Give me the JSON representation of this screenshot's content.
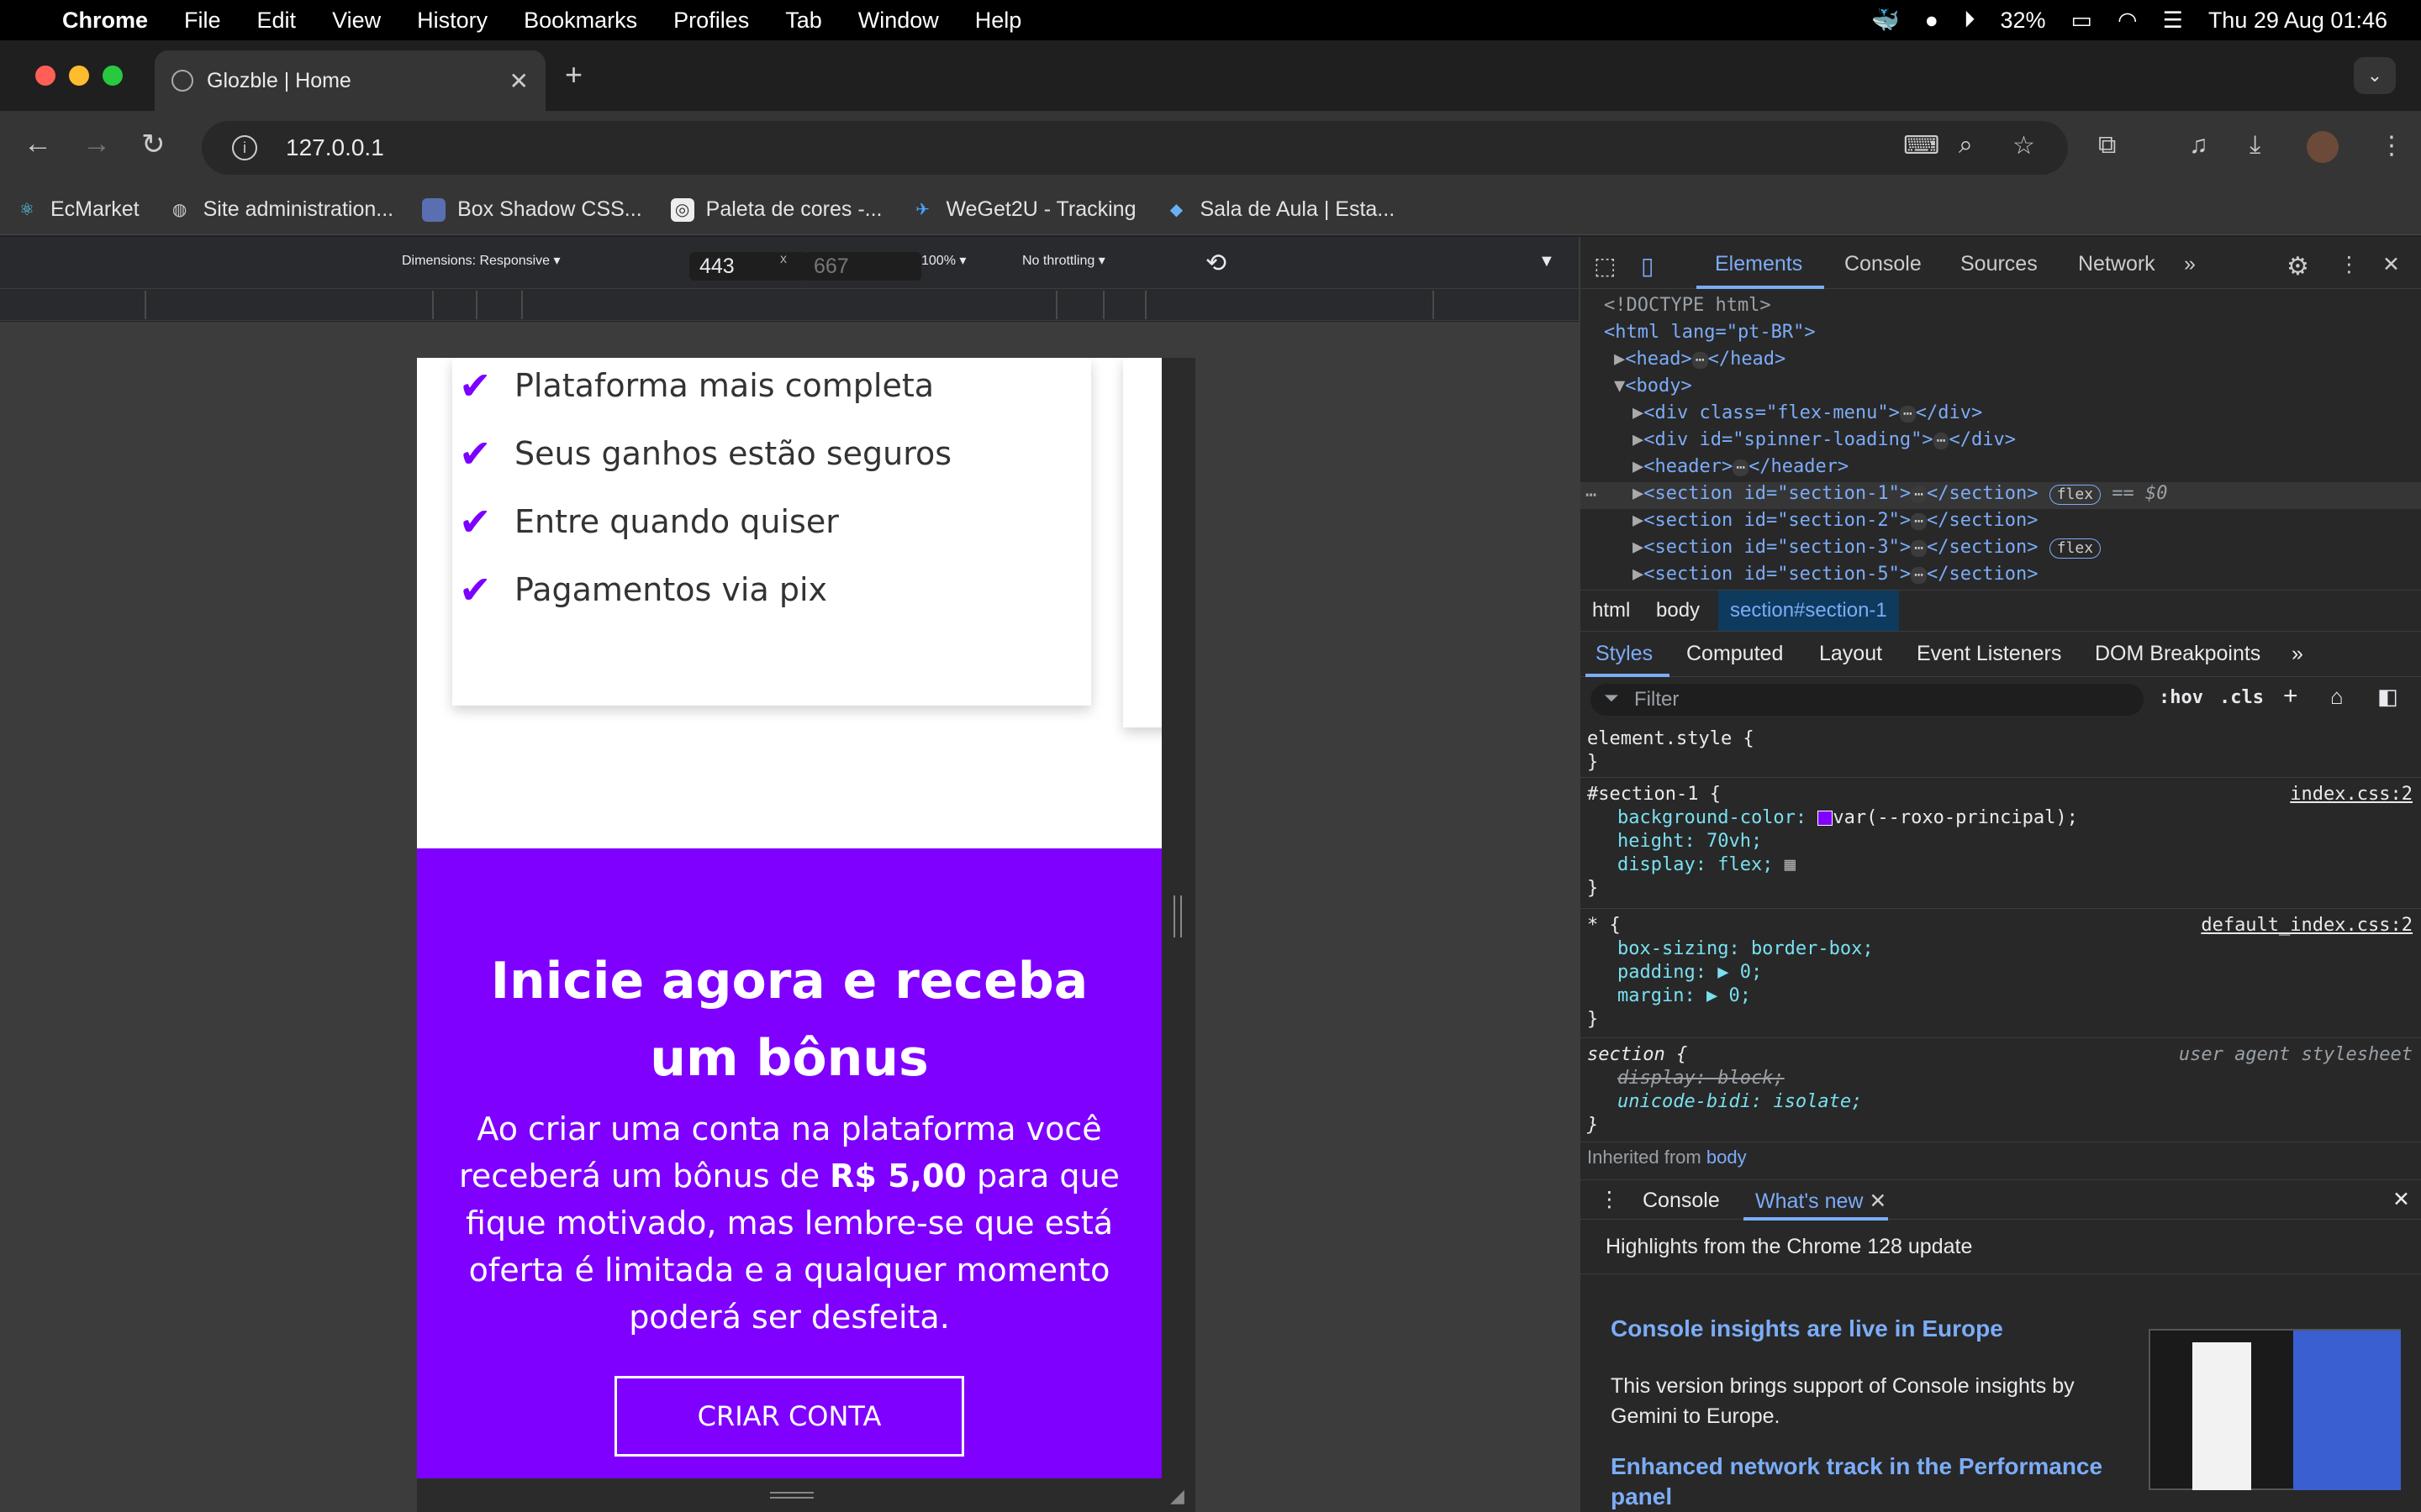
{
  "menubar": {
    "app": "Chrome",
    "items": [
      "File",
      "Edit",
      "View",
      "History",
      "Bookmarks",
      "Profiles",
      "Tab",
      "Window",
      "Help"
    ],
    "battery": "32%",
    "datetime": "Thu 29 Aug  01:46"
  },
  "tab": {
    "title": "Glozble | Home"
  },
  "omnibox": {
    "url": "127.0.0.1"
  },
  "bookmarks": [
    {
      "label": "EcMarket",
      "icon": "react-icon"
    },
    {
      "label": "Site administration...",
      "icon": "globe-icon"
    },
    {
      "label": "Box Shadow CSS...",
      "icon": "box-icon"
    },
    {
      "label": "Paleta de cores -...",
      "icon": "palette-icon"
    },
    {
      "label": "WeGet2U - Tracking",
      "icon": "tracking-icon"
    },
    {
      "label": "Sala de Aula | Esta...",
      "icon": "diamond-icon"
    }
  ],
  "device_toolbar": {
    "dimensions": "Dimensions: Responsive",
    "width": "443",
    "height": "667",
    "zoom": "100%",
    "throttling": "No throttling",
    "times": "x"
  },
  "page": {
    "features": [
      "Plataforma mais completa",
      "Seus ganhos estão seguros",
      "Entre quando quiser",
      "Pagamentos via pix"
    ],
    "cta_title": "Inicie agora e receba um bônus",
    "cta_text_before": "Ao criar uma conta na plataforma você receberá um bônus de",
    "cta_bonus": "R$ 5,00",
    "cta_text_after": "para que fique motivado, mas lembre-se que está oferta é limitada e a qualquer momento poderá ser desfeita.",
    "cta_button": "CRIAR CONTA"
  },
  "devtools": {
    "tabs": [
      "Elements",
      "Console",
      "Sources",
      "Network"
    ],
    "dom": {
      "doctype": "<!DOCTYPE html>",
      "html_open": "<html lang=\"pt-BR\">",
      "head": "<head>",
      "head_close": "</head>",
      "body": "<body>",
      "div_flex": "<div class=\"flex-menu\">",
      "div_close": "</div>",
      "div_spinner": "<div id=\"spinner-loading\">",
      "header": "<header>",
      "header_close": "</header>",
      "section1": "<section id=\"section-1\">",
      "section2": "<section id=\"section-2\">",
      "section3": "<section id=\"section-3\">",
      "section5": "<section id=\"section-5\">",
      "section_close": "</section>",
      "flex_badge": "flex",
      "eq": "== $0"
    },
    "breadcrumbs": [
      "html",
      "body",
      "section#section-1"
    ],
    "style_tabs": [
      "Styles",
      "Computed",
      "Layout",
      "Event Listeners",
      "DOM Breakpoints"
    ],
    "filter_placeholder": "Filter",
    "hov": ":hov",
    "cls": ".cls",
    "rules": {
      "element_style": "element.style {",
      "close": "}",
      "s1_selector": "#section-1 {",
      "s1_source": "index.css:2",
      "s1_bg": "background-color: ",
      "s1_bg_val": "var(--roxo-principal);",
      "s1_height": "height: 70vh;",
      "s1_display": "display: flex;",
      "star_selector": "* {",
      "star_source": "default_index.css:2",
      "star_box": "box-sizing: border-box;",
      "star_padding": "padding: ▶ 0;",
      "star_margin": "margin: ▶ 0;",
      "section_selector": "section {",
      "section_source": "user agent stylesheet",
      "section_display": "display: block;",
      "section_bidi": "unicode-bidi: isolate;",
      "inherited": "Inherited from",
      "inherited_el": "body"
    },
    "drawer_tabs": [
      "Console",
      "What's new"
    ],
    "whatsnew": {
      "highlights": "Highlights from the Chrome 128 update",
      "h1": "Console insights are live in Europe",
      "p1": "This version brings support of Console insights by Gemini to Europe.",
      "h2": "Enhanced network track in the Performance panel"
    }
  },
  "colors": {
    "purple": "#7f00ff",
    "link_blue": "#7cacf8"
  }
}
